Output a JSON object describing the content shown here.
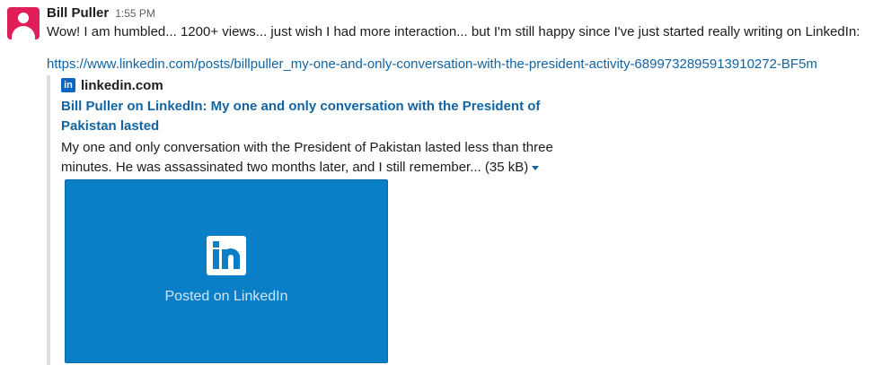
{
  "message": {
    "author": "Bill Puller",
    "time": "1:55 PM",
    "text": "Wow! I am humbled... 1200+ views... just wish I had more interaction... but I'm still happy since I've just started really writing on LinkedIn:",
    "url": "https://www.linkedin.com/posts/billpuller_my-one-and-only-conversation-with-the-president-activity-6899732895913910272-BF5m"
  },
  "attachment": {
    "service_icon": "linkedin-icon",
    "service_name": "linkedin.com",
    "title": "Bill Puller on LinkedIn: My one and only conversation with the President of Pakistan lasted",
    "description": "My one and only conversation with the President of Pakistan lasted less than three minutes. He was assassinated two months later, and I still remember...",
    "size": "(35 kB)",
    "preview_caption": "Posted on LinkedIn",
    "preview_color": "#0a7ec6"
  },
  "colors": {
    "link": "#1264a3",
    "avatar": "#e01e5a",
    "linkedin": "#0a66c2"
  }
}
